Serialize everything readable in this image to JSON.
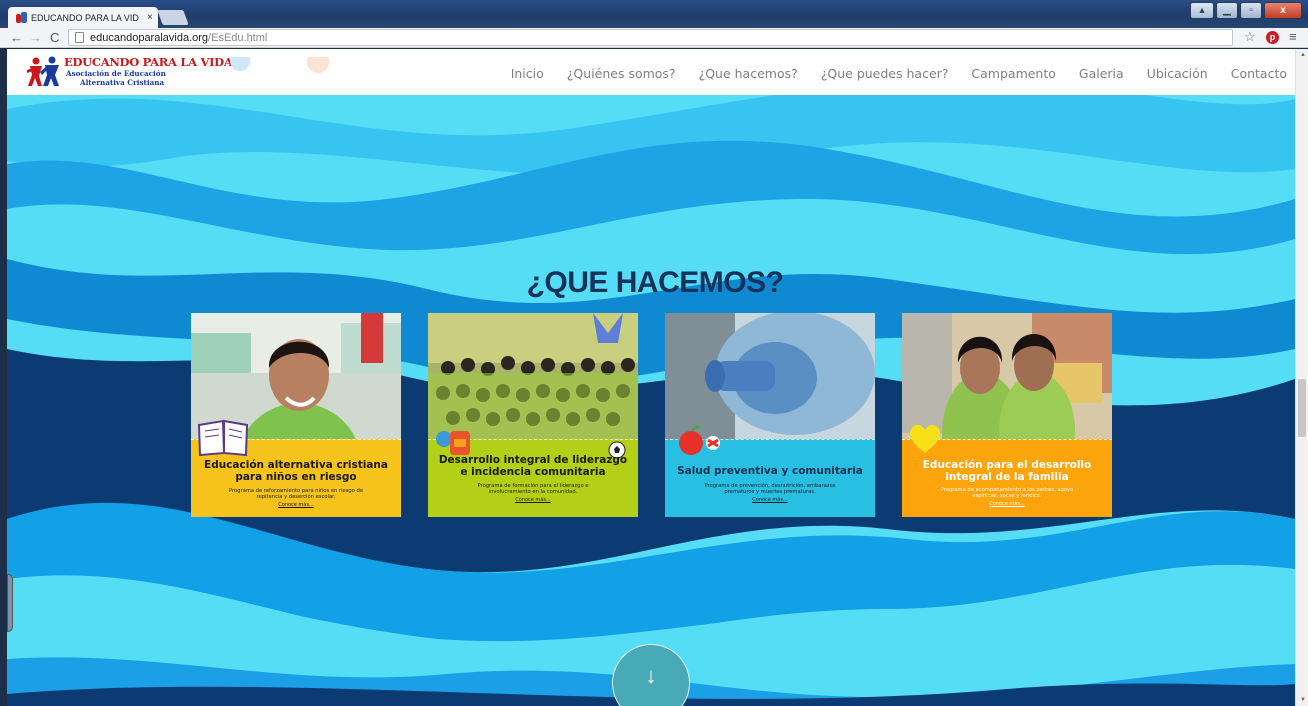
{
  "browser": {
    "tab_title": "EDUCANDO PARA LA VID",
    "tab_close": "×",
    "url_host": "educandoparalavida.org",
    "url_path": "/EsEdu.html",
    "back_glyph": "←",
    "forward_glyph": "→",
    "reload_glyph": "C",
    "star_glyph": "☆",
    "pin_glyph": "p",
    "menu_glyph": "≡",
    "icons": [
      "back-icon",
      "forward-icon",
      "reload-icon",
      "page-icon",
      "star-icon",
      "pinterest-icon",
      "menu-icon"
    ]
  },
  "site": {
    "logo_title": "EDUCANDO PARA LA VIDA",
    "logo_line1": "Asociación de Educación",
    "logo_line2": "Alternativa Cristiana",
    "logo_colors": {
      "red": "#c8181c",
      "blue": "#1a3a9c"
    },
    "nav": [
      {
        "label": "Inicio"
      },
      {
        "label": "¿Quiénes somos?"
      },
      {
        "label": "¿Que hacemos?"
      },
      {
        "label": "¿Que puedes hacer?"
      },
      {
        "label": "Campamento"
      },
      {
        "label": "Galeria"
      },
      {
        "label": "Ubicación"
      },
      {
        "label": "Contacto"
      }
    ]
  },
  "section": {
    "title": "¿QUE HACEMOS?",
    "title_color": "#15325a",
    "background_colors": [
      "#56ddf6",
      "#36bdf0",
      "#0e8fd8",
      "#0a3a72"
    ]
  },
  "cards": [
    {
      "title_line1": "Educación alternativa cristiana",
      "title_line2": "para niños en riesgo",
      "desc_line1": "Programa de reforzamiento para niños en riesgo de",
      "desc_line2": "repitencia y deserción escolar.",
      "more": "Conoce más...",
      "band_color": "#f6c21c",
      "icon": "book-icon"
    },
    {
      "title_line1": "Desarrollo integral de liderazgo",
      "title_line2": "e incidencia comunitaria",
      "desc_line1": "Programa de formación para el liderazgo e",
      "desc_line2": "involucramiento en la comunidad.",
      "more": "Conoce más...",
      "band_color": "#b3cf18",
      "icon": "backpack-icon"
    },
    {
      "title_line1": "Salud preventiva y comunitaria",
      "desc_line1": "Programa de prevención, desnutrición, embarazos",
      "desc_line2": "prematuros y muertes prematuras.",
      "more": "Conoce más...",
      "band_color": "#29bfe2",
      "icon": "apple-icon"
    },
    {
      "title_line1": "Educación para el desarrollo",
      "title_line2": "integral de la familia",
      "desc_line1": "Programa de acompañamiento a los padres, apoyo",
      "desc_line2": "espiritual, social y jurídico.",
      "more": "Conoce más...",
      "band_color": "#fca40c",
      "icon": "heart-icon"
    }
  ],
  "scroll_button": {
    "glyph": "↓",
    "icon": "arrow-down-icon"
  }
}
